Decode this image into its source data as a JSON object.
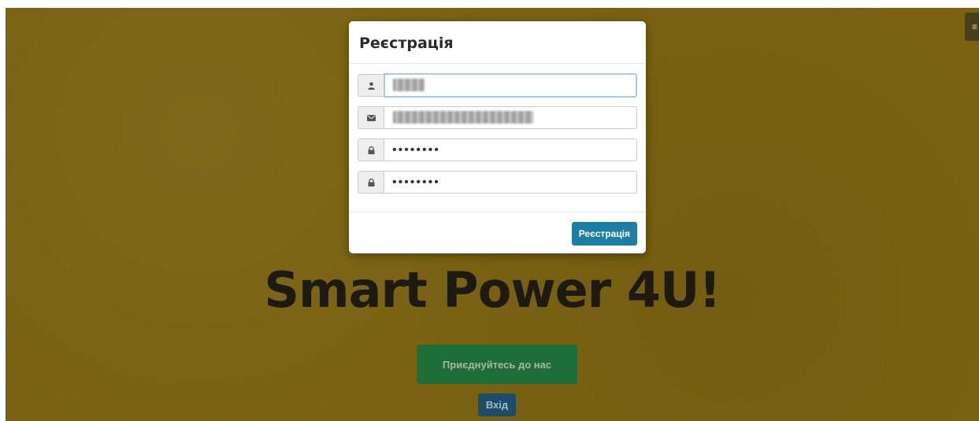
{
  "menu": {
    "icon": "menu-icon",
    "glyph": "≡"
  },
  "hero": {
    "title": "Smart Power 4U!",
    "join_label": "Приєднуйтесь до нас",
    "login_label": "Вхід"
  },
  "modal": {
    "title": "Реєстрація",
    "fields": [
      {
        "icon": "user-icon",
        "value": "",
        "redacted": true
      },
      {
        "icon": "envelope-icon",
        "value": "",
        "redacted": true
      },
      {
        "icon": "lock-icon",
        "value": "••••••••"
      },
      {
        "icon": "lock-icon",
        "value": "••••••••"
      }
    ],
    "submit_label": "Реєстрація"
  },
  "colors": {
    "background": "#7a6212",
    "join_button": "#1e6e3a",
    "login_button": "#1b4d6b",
    "submit_button": "#1d7ea1",
    "focus_border": "#a9c9ee"
  }
}
